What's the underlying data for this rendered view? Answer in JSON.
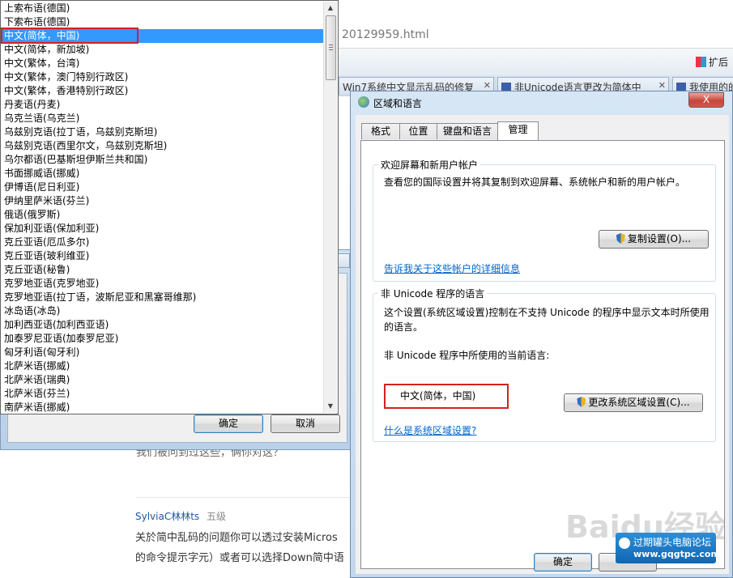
{
  "browser": {
    "address_text": "20129959.html",
    "extension_label": "扩后",
    "tabs": [
      "Win7系统中文显示乱码的修复",
      "非Unicode语言更改为简体中",
      "我使用的的"
    ]
  },
  "comment": {
    "line1": "我们被问到过这些，俩你对这？",
    "username": "SylviaC林林ts",
    "level": "五级",
    "text1": "关於简中乱码的问题你可以透过安装Micros",
    "text2": "的命令提示字元）或者可以选择Down简中语"
  },
  "back_dialog": {
    "ok_label": "确定",
    "cancel_label": "取消"
  },
  "dropdown": {
    "items": [
      "上索布语(德国)",
      "下索布语(德国)",
      "中文(简体，中国)",
      "中文(简体，新加坡)",
      "中文(繁体，台湾)",
      "中文(繁体，澳门特别行政区)",
      "中文(繁体，香港特别行政区)",
      "丹麦语(丹麦)",
      "乌克兰语(乌克兰)",
      "乌兹别克语(拉丁语，乌兹别克斯坦)",
      "乌兹别克语(西里尔文，乌兹别克斯坦)",
      "乌尔都语(巴基斯坦伊斯兰共和国)",
      "书面挪威语(挪威)",
      "伊博语(尼日利亚)",
      "伊纳里萨米语(芬兰)",
      "俄语(俄罗斯)",
      "保加利亚语(保加利亚)",
      "克丘亚语(厄瓜多尔)",
      "克丘亚语(玻利维亚)",
      "克丘亚语(秘鲁)",
      "克罗地亚语(克罗地亚)",
      "克罗地亚语(拉丁语，波斯尼亚和黑塞哥维那)",
      "冰岛语(冰岛)",
      "加利西亚语(加利西亚语)",
      "加泰罗尼亚语(加泰罗尼亚)",
      "匈牙利语(匈牙利)",
      "北萨米语(挪威)",
      "北萨米语(瑞典)",
      "北萨米语(芬兰)",
      "南萨米语(挪威)"
    ],
    "selected_index": 2
  },
  "region_dialog": {
    "title": "区域和语言",
    "close_label": "X",
    "tabs": [
      "格式",
      "位置",
      "键盘和语言",
      "管理"
    ],
    "active_tab": 3,
    "welcome_group": {
      "title": "欢迎屏幕和新用户帐户",
      "description": "查看您的国际设置并将其复制到欢迎屏幕、系统帐户和新的用户帐户。",
      "copy_button": "复制设置(O)...",
      "link": "告诉我关于这些帐户的详细信息"
    },
    "unicode_group": {
      "title": "非 Unicode 程序的语言",
      "description": "这个设置(系统区域设置)控制在不支持 Unicode 的程序中显示文本时所使用的语言。",
      "current_label": "非 Unicode 程序中所使用的当前语言:",
      "current_value": "中文(简体，中国)",
      "change_button": "更改系统区域设置(C)...",
      "link": "什么是系统区域设置?"
    },
    "ok_label": "确定"
  },
  "watermarks": {
    "baidu": "Baidu经验",
    "forum_name": "过期罐头电脑论坛",
    "forum_url": "www.gqgtpc.com"
  }
}
